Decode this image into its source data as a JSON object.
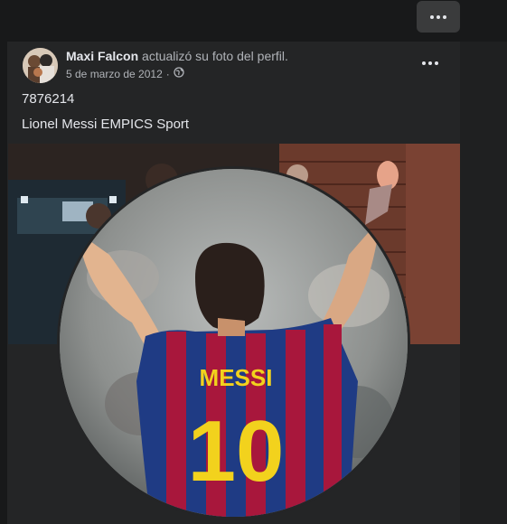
{
  "post": {
    "author": "Maxi Falcon",
    "action": "actualizó su foto del perfil.",
    "date": "5 de marzo de 2012",
    "separator": "·",
    "caption_line1": "7876214",
    "caption_line2": "Lionel Messi EMPICS Sport"
  },
  "photo": {
    "jersey_name": "MESSI",
    "jersey_number": "10"
  },
  "icons": {
    "top_more": "more-horizontal-icon",
    "post_more": "more-horizontal-icon",
    "privacy": "globe-icon"
  }
}
